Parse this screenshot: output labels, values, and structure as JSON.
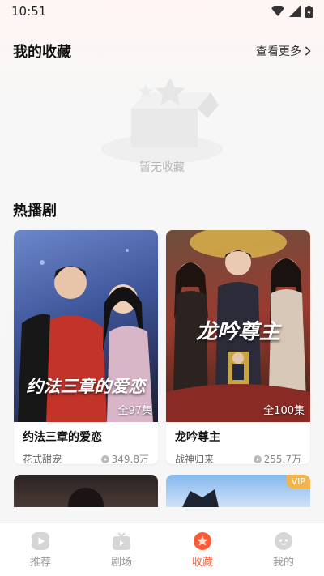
{
  "status_bar": {
    "time": "10:51"
  },
  "favorites": {
    "title": "我的收藏",
    "more_label": "查看更多",
    "empty_text": "暂无收藏"
  },
  "hot": {
    "title": "热播剧",
    "dramas": [
      {
        "poster_text": "约法三章的爱恋",
        "episodes": "全97集",
        "name": "约法三章的爱恋",
        "tag": "花式甜宠",
        "views": "349.8万"
      },
      {
        "poster_text": "龙吟尊主",
        "episodes": "全100集",
        "name": "龙吟尊主",
        "tag": "战神归来",
        "views": "255.7万"
      },
      {
        "vip": "VIP"
      }
    ]
  },
  "tabs": [
    {
      "label": "推荐",
      "icon": "play-icon"
    },
    {
      "label": "剧场",
      "icon": "tv-icon"
    },
    {
      "label": "收藏",
      "icon": "star-icon",
      "active": true
    },
    {
      "label": "我的",
      "icon": "profile-face-icon"
    }
  ],
  "colors": {
    "accent": "#ff5a35",
    "vip": "#f3b54a"
  }
}
